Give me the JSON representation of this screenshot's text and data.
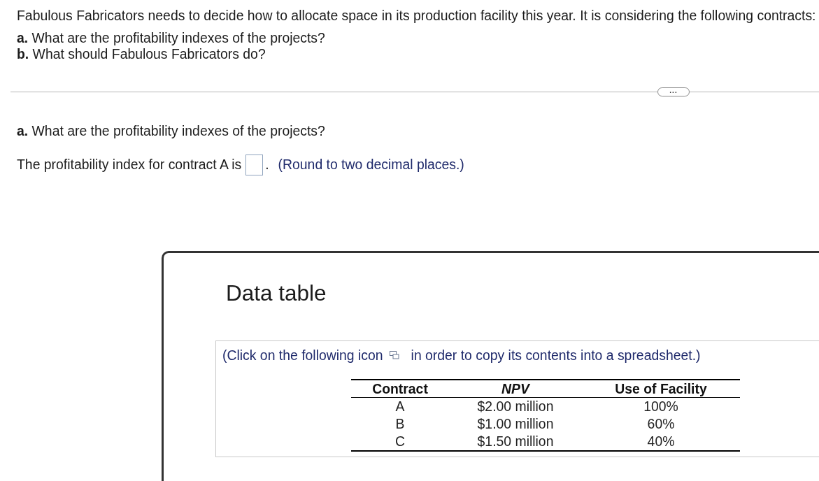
{
  "problem": {
    "intro": "Fabulous Fabricators needs to decide how to allocate space in its production facility this year. It is considering the following contracts:",
    "questions": [
      "**a.** What are the profitability indexes of the projects?",
      "**b.** What should Fabulous Fabricators do?"
    ]
  },
  "more_button": {
    "label": "..."
  },
  "part_a": {
    "heading": "**a.** What are the profitability indexes of the projects?",
    "prompt": "The profitability index for contract A is",
    "after_field": ".",
    "hint": "(Round to two decimal places.)"
  },
  "data_table": {
    "title": "Data table",
    "instruction_start": "(Click on the following icon",
    "instruction_end": "in order to copy its contents into a spreadsheet.)",
    "columns": [
      {
        "label": "Contract",
        "italic": false
      },
      {
        "label": "NPV",
        "italic": true
      },
      {
        "label": "Use of Facility",
        "italic": false
      }
    ],
    "rows": [
      [
        "A",
        "$2.00 million",
        "100%"
      ],
      [
        "B",
        "$1.00 million",
        "60%"
      ],
      [
        "C",
        "$1.50 million",
        "40%"
      ]
    ]
  }
}
